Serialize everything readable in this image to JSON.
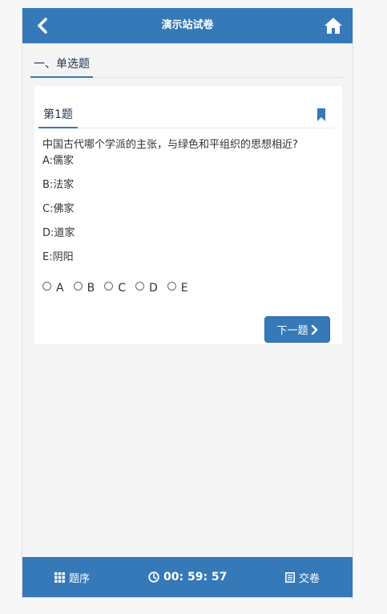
{
  "header": {
    "title": "演示站试卷"
  },
  "section": {
    "title": "一、单选题"
  },
  "question": {
    "number_label": "第1题",
    "text": "中国古代哪个学派的主张，与绿色和平组织的思想相近?",
    "options": [
      "A:儒家",
      "B:法家",
      "C:佛家",
      "D:道家",
      "E:阴阳"
    ],
    "answer_choices": [
      "A",
      "B",
      "C",
      "D",
      "E"
    ]
  },
  "next_button": {
    "label": "下一题"
  },
  "footer": {
    "index_label": "题序",
    "timer": "00: 59: 57",
    "submit_label": "交卷"
  },
  "colors": {
    "primary": "#3579b8",
    "page_bg": "#f4f4f4"
  }
}
